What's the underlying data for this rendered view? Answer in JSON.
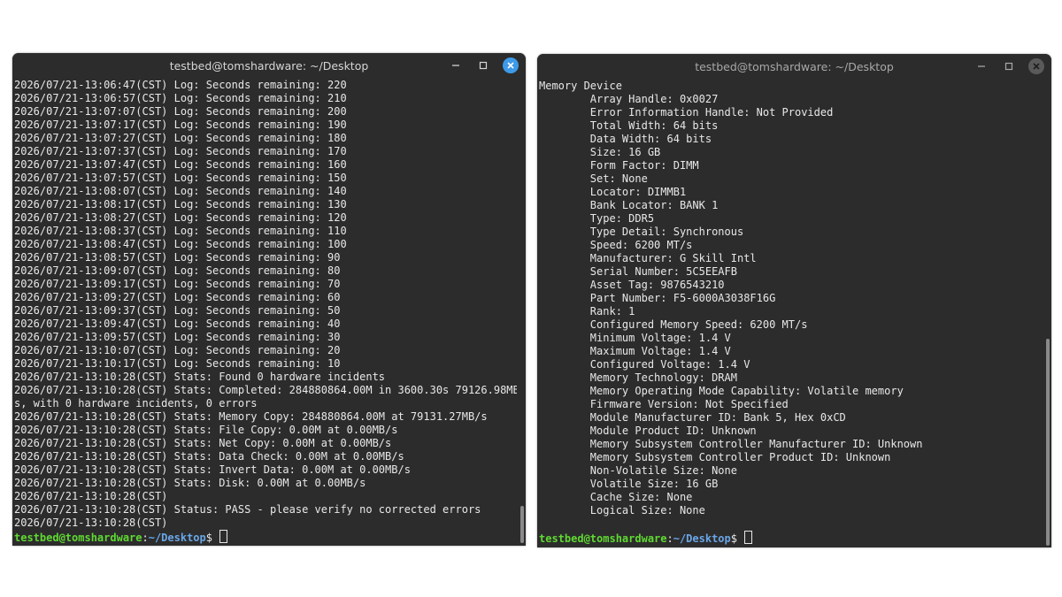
{
  "left_window": {
    "title": "testbed@tomshardware: ~/Desktop",
    "lines": [
      "2026/07/21-13:06:47(CST) Log: Seconds remaining: 220",
      "2026/07/21-13:06:57(CST) Log: Seconds remaining: 210",
      "2026/07/21-13:07:07(CST) Log: Seconds remaining: 200",
      "2026/07/21-13:07:17(CST) Log: Seconds remaining: 190",
      "2026/07/21-13:07:27(CST) Log: Seconds remaining: 180",
      "2026/07/21-13:07:37(CST) Log: Seconds remaining: 170",
      "2026/07/21-13:07:47(CST) Log: Seconds remaining: 160",
      "2026/07/21-13:07:57(CST) Log: Seconds remaining: 150",
      "2026/07/21-13:08:07(CST) Log: Seconds remaining: 140",
      "2026/07/21-13:08:17(CST) Log: Seconds remaining: 130",
      "2026/07/21-13:08:27(CST) Log: Seconds remaining: 120",
      "2026/07/21-13:08:37(CST) Log: Seconds remaining: 110",
      "2026/07/21-13:08:47(CST) Log: Seconds remaining: 100",
      "2026/07/21-13:08:57(CST) Log: Seconds remaining: 90",
      "2026/07/21-13:09:07(CST) Log: Seconds remaining: 80",
      "2026/07/21-13:09:17(CST) Log: Seconds remaining: 70",
      "2026/07/21-13:09:27(CST) Log: Seconds remaining: 60",
      "2026/07/21-13:09:37(CST) Log: Seconds remaining: 50",
      "2026/07/21-13:09:47(CST) Log: Seconds remaining: 40",
      "2026/07/21-13:09:57(CST) Log: Seconds remaining: 30",
      "2026/07/21-13:10:07(CST) Log: Seconds remaining: 20",
      "2026/07/21-13:10:17(CST) Log: Seconds remaining: 10",
      "2026/07/21-13:10:28(CST) Stats: Found 0 hardware incidents",
      "2026/07/21-13:10:28(CST) Stats: Completed: 284880864.00M in 3600.30s 79126.98MB/",
      "s, with 0 hardware incidents, 0 errors",
      "2026/07/21-13:10:28(CST) Stats: Memory Copy: 284880864.00M at 79131.27MB/s",
      "2026/07/21-13:10:28(CST) Stats: File Copy: 0.00M at 0.00MB/s",
      "2026/07/21-13:10:28(CST) Stats: Net Copy: 0.00M at 0.00MB/s",
      "2026/07/21-13:10:28(CST) Stats: Data Check: 0.00M at 0.00MB/s",
      "2026/07/21-13:10:28(CST) Stats: Invert Data: 0.00M at 0.00MB/s",
      "2026/07/21-13:10:28(CST) Stats: Disk: 0.00M at 0.00MB/s",
      "2026/07/21-13:10:28(CST)",
      "2026/07/21-13:10:28(CST) Status: PASS - please verify no corrected errors",
      "2026/07/21-13:10:28(CST)"
    ],
    "prompt": {
      "user": "testbed@tomshardware",
      "sep": ":",
      "path": "~/Desktop",
      "symbol": "$ "
    }
  },
  "right_window": {
    "title": "testbed@tomshardware: ~/Desktop",
    "lines": [
      "Memory Device",
      "\tArray Handle: 0x0027",
      "\tError Information Handle: Not Provided",
      "\tTotal Width: 64 bits",
      "\tData Width: 64 bits",
      "\tSize: 16 GB",
      "\tForm Factor: DIMM",
      "\tSet: None",
      "\tLocator: DIMMB1",
      "\tBank Locator: BANK 1",
      "\tType: DDR5",
      "\tType Detail: Synchronous",
      "\tSpeed: 6200 MT/s",
      "\tManufacturer: G Skill Intl",
      "\tSerial Number: 5C5EEAFB",
      "\tAsset Tag: 9876543210",
      "\tPart Number: F5-6000A3038F16G",
      "\tRank: 1",
      "\tConfigured Memory Speed: 6200 MT/s",
      "\tMinimum Voltage: 1.4 V",
      "\tMaximum Voltage: 1.4 V",
      "\tConfigured Voltage: 1.4 V",
      "\tMemory Technology: DRAM",
      "\tMemory Operating Mode Capability: Volatile memory",
      "\tFirmware Version: Not Specified",
      "\tModule Manufacturer ID: Bank 5, Hex 0xCD",
      "\tModule Product ID: Unknown",
      "\tMemory Subsystem Controller Manufacturer ID: Unknown",
      "\tMemory Subsystem Controller Product ID: Unknown",
      "\tNon-Volatile Size: None",
      "\tVolatile Size: 16 GB",
      "\tCache Size: None",
      "\tLogical Size: None",
      ""
    ],
    "prompt": {
      "user": "testbed@tomshardware",
      "sep": ":",
      "path": "~/Desktop",
      "symbol": "$ "
    }
  },
  "colors": {
    "terminal_bg": "#2c2c2c",
    "text": "#e8e8e8",
    "prompt_user": "#5fd932",
    "prompt_path": "#6aa6e8",
    "close_active": "#3d9ae8"
  },
  "icons": [
    "minimize-icon",
    "maximize-icon",
    "close-icon"
  ]
}
